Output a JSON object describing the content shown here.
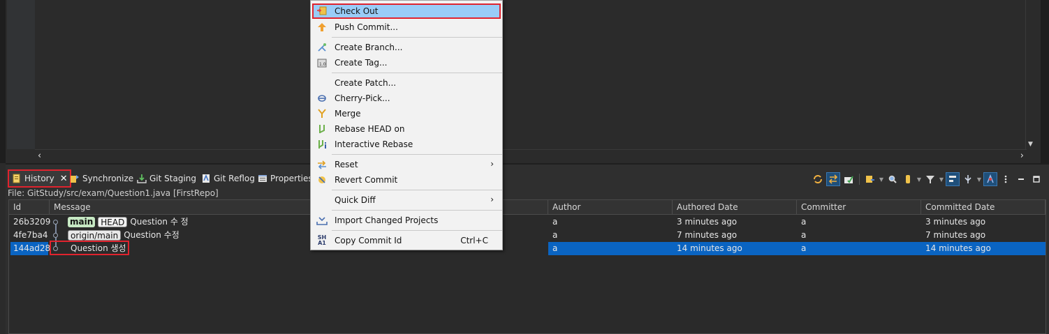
{
  "tabs": [
    {
      "id": "history",
      "label": "History",
      "active": true,
      "icon": "history-icon"
    },
    {
      "id": "synchronize",
      "label": "Synchronize",
      "icon": "synchronize-icon"
    },
    {
      "id": "git-staging",
      "label": "Git Staging",
      "icon": "git-staging-icon"
    },
    {
      "id": "git-reflog",
      "label": "Git Reflog",
      "icon": "git-reflog-icon"
    },
    {
      "id": "properties",
      "label": "Properties",
      "icon": "properties-icon"
    }
  ],
  "file_path": "File: GitStudy/src/exam/Question1.java [FirstRepo]",
  "table": {
    "columns": [
      "Id",
      "Message",
      "Author",
      "Authored Date",
      "Committer",
      "Committed Date"
    ],
    "rows": [
      {
        "id": "26b3209",
        "refs": [
          {
            "label": "main",
            "type": "branch"
          },
          {
            "label": "HEAD",
            "type": "head"
          }
        ],
        "message": "Question 수 정",
        "author": "a",
        "authored_date": "3 minutes ago",
        "committer": "a",
        "committed_date": "3 minutes ago",
        "selected": false
      },
      {
        "id": "4fe7ba4",
        "refs": [
          {
            "label": "origin/main",
            "type": "remote"
          }
        ],
        "message": "Question 수정",
        "author": "a",
        "authored_date": "7 minutes ago",
        "committer": "a",
        "committed_date": "7 minutes ago",
        "selected": false
      },
      {
        "id": "144ad28",
        "refs": [],
        "message": "Question 생성",
        "author": "a",
        "authored_date": "14 minutes ago",
        "committer": "a",
        "committed_date": "14 minutes ago",
        "selected": true
      }
    ]
  },
  "context_menu": {
    "items": [
      {
        "label": "Check Out",
        "icon": "checkout-icon",
        "hover": true
      },
      {
        "label": "Push Commit...",
        "icon": "push-commit-icon"
      },
      {
        "separator": true
      },
      {
        "label": "Create Branch...",
        "icon": "create-branch-icon"
      },
      {
        "label": "Create Tag...",
        "icon": "create-tag-icon"
      },
      {
        "separator": true
      },
      {
        "label": "Create Patch...",
        "icon": ""
      },
      {
        "label": "Cherry-Pick...",
        "icon": "cherry-pick-icon"
      },
      {
        "label": "Merge",
        "icon": "merge-icon"
      },
      {
        "label": "Rebase HEAD on",
        "icon": "rebase-icon"
      },
      {
        "label": "Interactive Rebase",
        "icon": "interactive-rebase-icon"
      },
      {
        "separator": true
      },
      {
        "label": "Reset",
        "icon": "",
        "submenu": true
      },
      {
        "label": "Revert Commit",
        "icon": "revert-commit-icon"
      },
      {
        "separator": true
      },
      {
        "label": "Quick Diff",
        "icon": "",
        "submenu": true
      },
      {
        "separator": true
      },
      {
        "label": "Import Changed Projects",
        "icon": "import-projects-icon"
      },
      {
        "separator": true
      },
      {
        "label": "Copy Commit Id",
        "icon": "sha1-icon",
        "shortcut": "Ctrl+C"
      }
    ]
  },
  "sha_icon_text": [
    "SH",
    "A1"
  ],
  "colors": {
    "selection": "#0a64c2",
    "menu_hover": "#99ccf7",
    "highlight_box": "#e0232e",
    "branch_badge": "#c6e8c3"
  }
}
